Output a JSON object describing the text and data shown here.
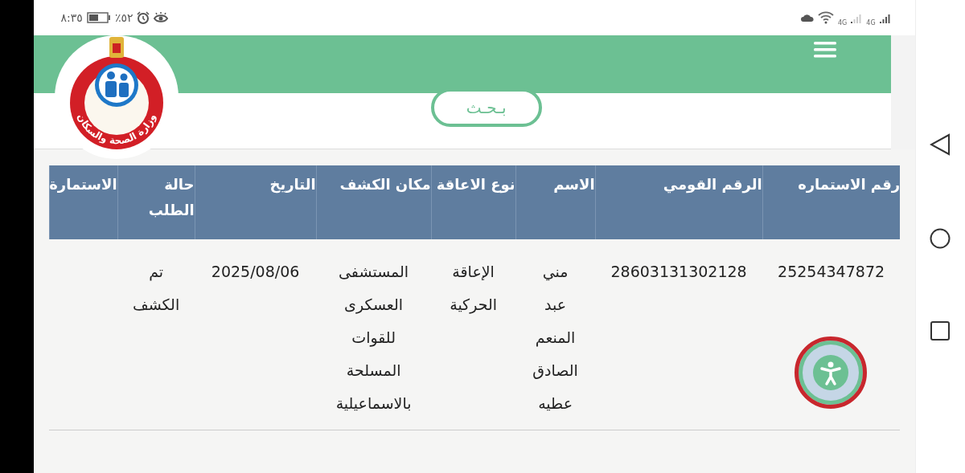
{
  "status_bar": {
    "time": "٨:٣٥",
    "battery_percent": "٪٥٢",
    "network_labels": [
      "4G",
      "4G"
    ]
  },
  "header": {
    "logo_text": "وزارة الصحة والسكان",
    "search_button": "بـحـث"
  },
  "table": {
    "columns": [
      "رقم الاستماره",
      "الرقم القومي",
      "الاسم",
      "نوع الاعاقة",
      "مكان الكشف",
      "التاريخ",
      "حالة الطلب",
      "الاستمارة"
    ],
    "rows": [
      {
        "cells": [
          "25254347872",
          "28603131302128",
          "مني عبد المنعم الصادق عطيه",
          "الإعاقة الحركية",
          "المستشفى العسكرى للقوات المسلحة بالاسماعيلية",
          "2025/08/06",
          "تم الكشف"
        ]
      }
    ]
  }
}
